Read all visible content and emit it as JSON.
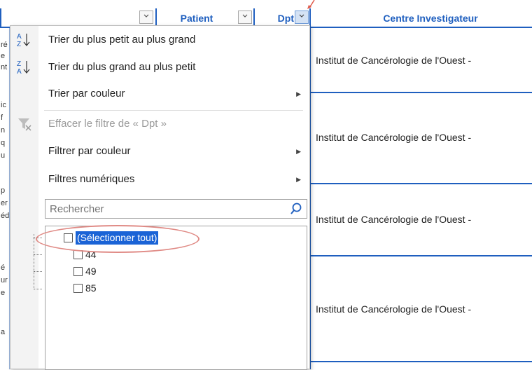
{
  "header": {
    "patient_label": "Patient",
    "dpt_label": "Dpt",
    "centre_label": "Centre Investigateur"
  },
  "rows": [
    {
      "centre": "Institut de Cancérologie de l'Ouest -"
    },
    {
      "centre": "Institut de Cancérologie de l'Ouest -"
    },
    {
      "centre": "Institut de Cancérologie de l'Ouest -"
    },
    {
      "centre": "Institut de Cancérologie de l'Ouest -"
    }
  ],
  "left_fragments": [
    "ré",
    "e",
    "nt",
    "ic",
    "f",
    "n",
    "q",
    "u",
    "p",
    "er",
    "éd",
    "é",
    "ur",
    "e",
    "a"
  ],
  "menu": {
    "sort_asc": {
      "label": "Trier du plus petit au plus grand",
      "icon": "sort-ascending-icon"
    },
    "sort_desc": {
      "label": "Trier du plus grand au plus petit",
      "icon": "sort-descending-icon"
    },
    "sort_color": {
      "label": "Trier par couleur"
    },
    "clear_filter": {
      "label": "Effacer le filtre de « Dpt »",
      "icon": "clear-filter-icon"
    },
    "filter_color": {
      "label": "Filtrer par couleur"
    },
    "numeric_filters": {
      "label": "Filtres numériques"
    }
  },
  "search": {
    "placeholder": "Rechercher",
    "icon": "magnifier-icon"
  },
  "values_list": [
    {
      "label": "(Sélectionner tout)",
      "checked": false,
      "selected": true
    },
    {
      "label": "44",
      "checked": false
    },
    {
      "label": "49",
      "checked": false
    },
    {
      "label": "85",
      "checked": false
    }
  ],
  "colors": {
    "accent_blue": "#1f5fbf",
    "selection": "#1a63d6",
    "highlight": "#e08b86"
  }
}
